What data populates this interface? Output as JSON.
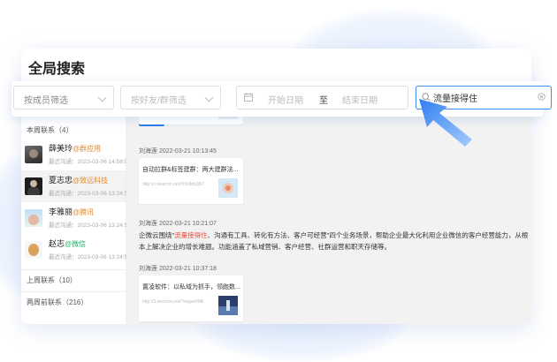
{
  "window": {
    "title": "全局搜索"
  },
  "filters": {
    "member": {
      "label": "按成员筛选"
    },
    "friend": {
      "label": "按好友/群筛选"
    },
    "date": {
      "start": "开始日期",
      "separator": "至",
      "end": "结束日期"
    },
    "search": {
      "value": "流量接得住"
    }
  },
  "sidebar": {
    "this_week": "本周联系（4）",
    "contacts": [
      {
        "name": "薛美玲",
        "tag": "@群应用",
        "tag_color": "#e58a2b",
        "time": "最近沟通：2023-03-06 14:58:00"
      },
      {
        "name": "夏志忠",
        "tag": "@致远科技",
        "tag_color": "#e58a2b",
        "time": "最近沟通：2023-03-06 13:24:55"
      },
      {
        "name": "李雅丽",
        "tag": "@腾讯",
        "tag_color": "#e58a2b",
        "time": "最近沟通：2023-03-06 13:24:55"
      },
      {
        "name": "赵志",
        "tag": "@微信",
        "tag_color": "#2aae67",
        "time": "最近沟通：2023-03-06 13:24:55"
      }
    ],
    "last_week": "上周联系（10）",
    "two_weeks": "两周前联系（216）"
  },
  "chat": {
    "badge": "刘海莲",
    "messages": [
      {
        "meta": "刘海莲   2022-03-21 10:13:45",
        "card_title": "自动拉群&标签建群：两大建群法...",
        "card_url": "http://c.wescrm.net/?rtX8dsQ57"
      },
      {
        "meta": "刘海莲   2022-03-21 10:21:07",
        "text_before": "企微云围绕\"",
        "text_highlight": "流量接得住",
        "text_after": "、沟通有工具、转化有方法、客户可经营\"四个业务场景，帮助企业最大化利用企业微信的客户经营能力，从根",
        "text_line2": "本上解决企业的增长难题。功能涵盖了私域营销、客户经营、社群运营和职天存储等。"
      },
      {
        "meta": "刘海莲   2022-03-21 10:37:18",
        "card_title": "置凌软件：以私域为抓手，领跑数...",
        "card_url": "http://3.wescrm.net/?ssgaeVMk"
      }
    ]
  },
  "colors": {
    "accent": "#2b80f0",
    "highlight": "#e74c3c"
  }
}
